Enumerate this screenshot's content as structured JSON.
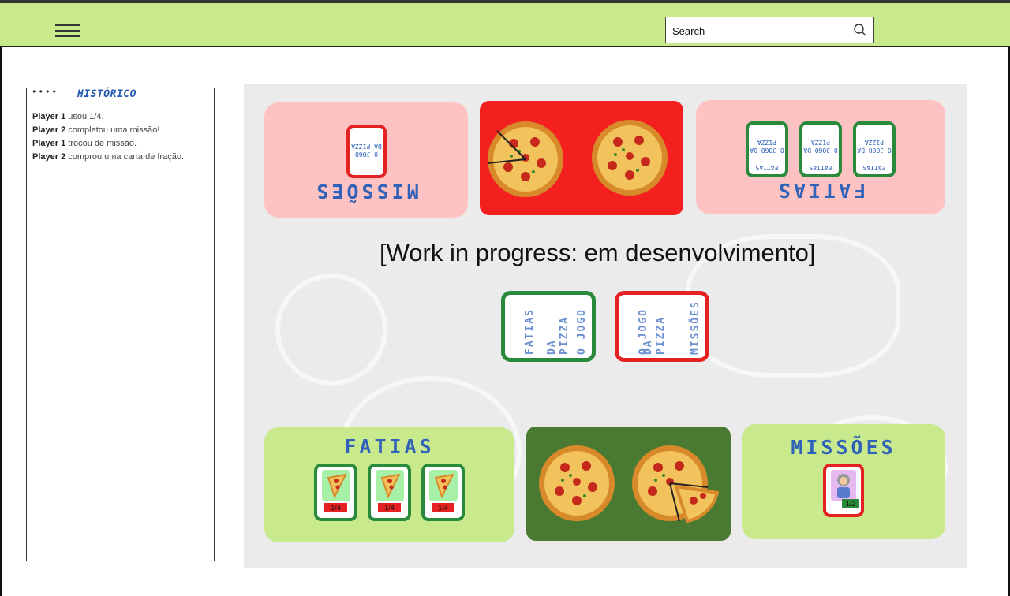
{
  "header": {
    "search_placeholder": "Search",
    "menu_icon": "hamburger-icon",
    "search_icon": "magnifier-icon",
    "bg_color": "#c9e98d"
  },
  "history": {
    "title": "HISTÓRICO",
    "dots": "••••",
    "entries": [
      {
        "player": "Player 1",
        "text": " usou 1/4."
      },
      {
        "player": "Player 2",
        "text": " completou uma missão!"
      },
      {
        "player": "Player 1",
        "text": " trocou de missão."
      },
      {
        "player": "Player 2",
        "text": " comprou uma carta de fração."
      }
    ]
  },
  "board": {
    "opponent": {
      "missions_title": "MISSÕES",
      "slices_title": "FATIAS",
      "card_back_text": "O JOGO DA PIZZA",
      "card_back_slices_label": "FATIAS",
      "tray_color": "#f41f1f"
    },
    "center": {
      "wip_text": "[Work in progress: em desenvolvimento]",
      "slices_deck": {
        "line1": "O JOGO",
        "line2": "DA PIZZA",
        "line3": "FATIAS"
      },
      "missions_deck": {
        "line1": "O JOGO",
        "line2": "DA PIZZA",
        "line3": "MISSÕES"
      }
    },
    "player": {
      "slices_title": "FATIAS",
      "missions_title": "MISSÕES",
      "slice_cards": [
        "1/4",
        "1/4",
        "1/4"
      ],
      "mission_card_value": "1/2",
      "tray_color": "#4a7a32"
    }
  }
}
